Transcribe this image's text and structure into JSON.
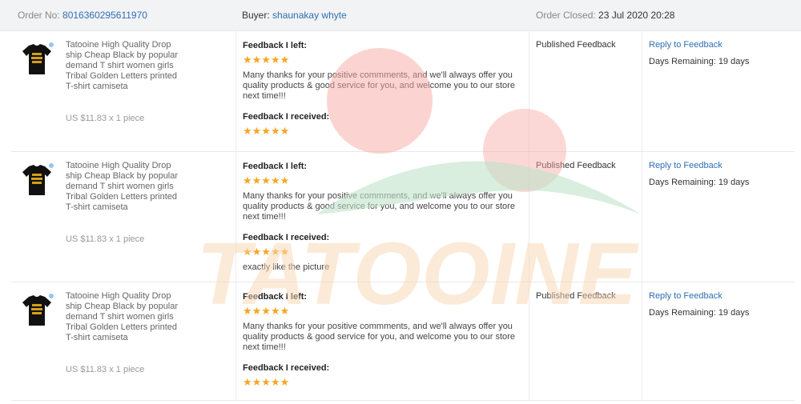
{
  "order": {
    "number_label": "Order No:",
    "number_value": "8016360295611970",
    "buyer_label": "Buyer:",
    "buyer_name": "shaunakay whyte",
    "closed_label": "Order Closed:",
    "closed_value": "23 Jul 2020 20:28"
  },
  "watermark_text": "TATOOINE",
  "colors": {
    "link": "#2f6fb3",
    "star": "#f5a623",
    "header_bg": "#f2f3f5",
    "watermark_red": "#f7a9a5",
    "watermark_green": "#bfe3c8",
    "watermark_orange": "#fbd7b4"
  },
  "items": [
    {
      "title": "Tatooine High Quality Drop ship Cheap Black by popular demand T shirt women girls Tribal Golden Letters printed T-shirt camiseta",
      "price": "US $11.83 x 1 piece",
      "feedback_left_label": "Feedback I left:",
      "feedback_left_stars": "★★★★★",
      "feedback_left_text": "Many thanks for your positive commments, and we'll always offer you quality products & good service for you, and welcome you to our store next time!!!",
      "feedback_received_label": "Feedback I received:",
      "feedback_received_stars": "★★★★★",
      "feedback_received_text": "",
      "status": "Published Feedback",
      "reply_label": "Reply to Feedback",
      "days_remaining": "Days Remaining: 19 days"
    },
    {
      "title": "Tatooine High Quality Drop ship Cheap Black by popular demand T shirt women girls Tribal Golden Letters printed T-shirt camiseta",
      "price": "US $11.83 x 1 piece",
      "feedback_left_label": "Feedback I left:",
      "feedback_left_stars": "★★★★★",
      "feedback_left_text": "Many thanks for your positive commments, and we'll always offer you quality products & good service for you, and welcome you to our store next time!!!",
      "feedback_received_label": "Feedback I received:",
      "feedback_received_stars": "★★★★★",
      "feedback_received_text": "exactly like the picture",
      "status": "Published Feedback",
      "reply_label": "Reply to Feedback",
      "days_remaining": "Days Remaining: 19 days"
    },
    {
      "title": "Tatooine High Quality Drop ship Cheap Black by popular demand T shirt women girls Tribal Golden Letters printed T-shirt camiseta",
      "price": "US $11.83 x 1 piece",
      "feedback_left_label": "Feedback I left:",
      "feedback_left_stars": "★★★★★",
      "feedback_left_text": "Many thanks for your positive commments, and we'll always offer you quality products & good service for you, and welcome you to our store next time!!!",
      "feedback_received_label": "Feedback I received:",
      "feedback_received_stars": "★★★★★",
      "feedback_received_text": "",
      "status": "Published Feedback",
      "reply_label": "Reply to Feedback",
      "days_remaining": "Days Remaining: 19 days"
    }
  ]
}
